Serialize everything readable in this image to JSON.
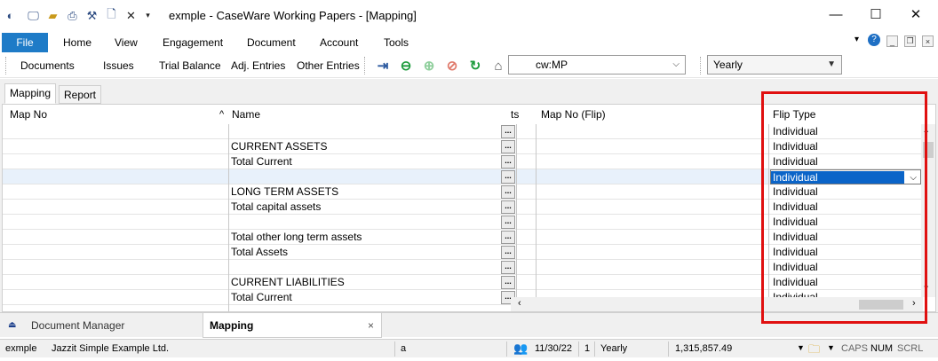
{
  "window": {
    "title": "exmple - CaseWare Working Papers - [Mapping]",
    "controls": {
      "minimize": "—",
      "maximize": "☐",
      "close": "✕"
    }
  },
  "menu": {
    "file": "File",
    "items": [
      "Home",
      "View",
      "Engagement",
      "Document",
      "Account",
      "Tools"
    ]
  },
  "toolbar": {
    "items": [
      "Documents",
      "Issues",
      "Trial Balance",
      "Adj. Entries",
      "Other Entries"
    ],
    "document_combo": "cw:MP",
    "period_combo": "Yearly"
  },
  "tabs": [
    "Mapping",
    "Report"
  ],
  "grid": {
    "headers": {
      "map_no": "Map No",
      "name": "Name",
      "ts": "ts",
      "map_no_flip": "Map No (Flip)",
      "flip_type": "Flip Type"
    },
    "rows": [
      {
        "name": "",
        "flip_type": "Individual"
      },
      {
        "name": "CURRENT ASSETS",
        "flip_type": "Individual"
      },
      {
        "name": "Total Current",
        "flip_type": "Individual"
      },
      {
        "name": "",
        "flip_type": "Individual"
      },
      {
        "name": "LONG TERM ASSETS",
        "flip_type": "Individual"
      },
      {
        "name": "Total capital assets",
        "flip_type": "Individual"
      },
      {
        "name": "",
        "flip_type": "Individual"
      },
      {
        "name": "Total other long term assets",
        "flip_type": "Individual"
      },
      {
        "name": "Total Assets",
        "flip_type": "Individual"
      },
      {
        "name": "",
        "flip_type": "Individual"
      },
      {
        "name": "CURRENT LIABILITIES",
        "flip_type": "Individual"
      },
      {
        "name": "Total Current",
        "flip_type": "Individual"
      }
    ],
    "dots_label": "..."
  },
  "bottom_tabs": {
    "document_manager": "Document Manager",
    "mapping": "Mapping",
    "close": "×"
  },
  "status": {
    "entity": "exmple",
    "company": "Jazzit Simple Example Ltd.",
    "a": "a",
    "date": "11/30/22",
    "period_num": "1",
    "period": "Yearly",
    "amount": "1,315,857.49",
    "caps": "CAPS",
    "num": "NUM",
    "scrl": "SCRL"
  },
  "colors": {
    "file_button": "#1e7bc7",
    "selection": "#0a64c8",
    "highlight": "#e01010"
  }
}
